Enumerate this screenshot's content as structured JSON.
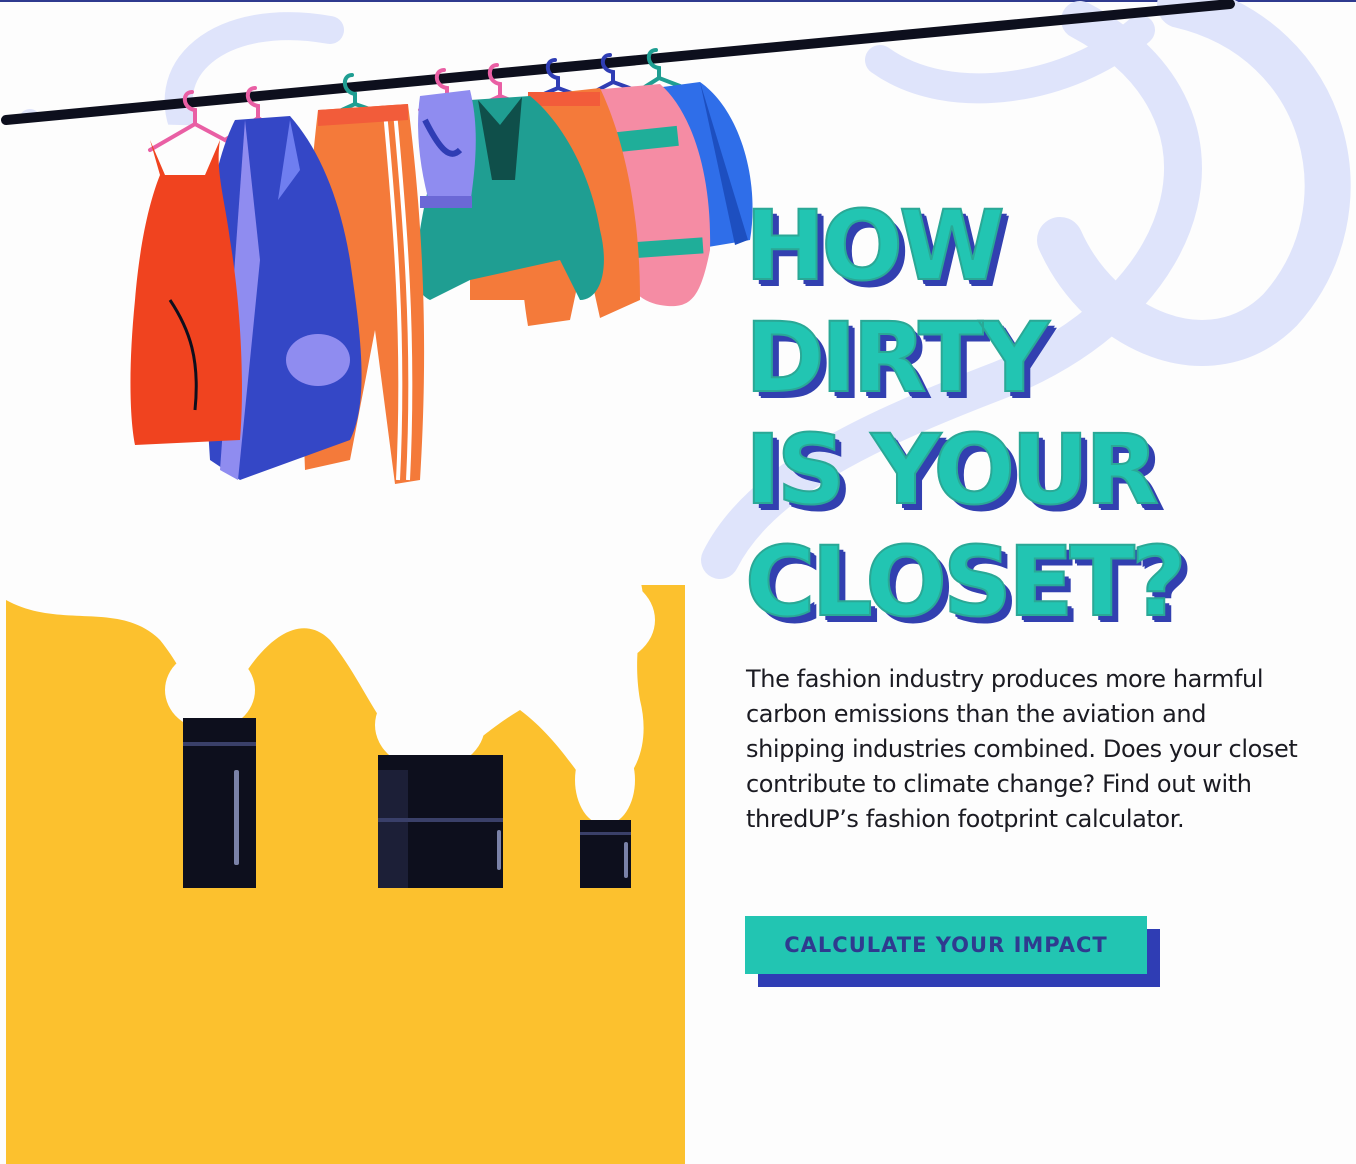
{
  "hero": {
    "title_lines": [
      "HOW",
      "DIRTY",
      "IS YOUR",
      "CLOSET?"
    ],
    "body": "The fashion industry produces more harmful carbon emissions than the aviation and shipping industries combined. Does your closet contribute to climate change? Find out with thredUP’s fashion footprint calculator.",
    "cta_label": "CALCULATE YOUR IMPACT"
  },
  "illustration": {
    "subject": "clothes-rack-over-factory-smokestacks",
    "colors": {
      "yellow": "#fcc12e",
      "teal": "#22c5b2",
      "navy": "#2f3a8f",
      "smokestack": "#0d0f1d",
      "swirl": "#dfe4fb"
    }
  }
}
